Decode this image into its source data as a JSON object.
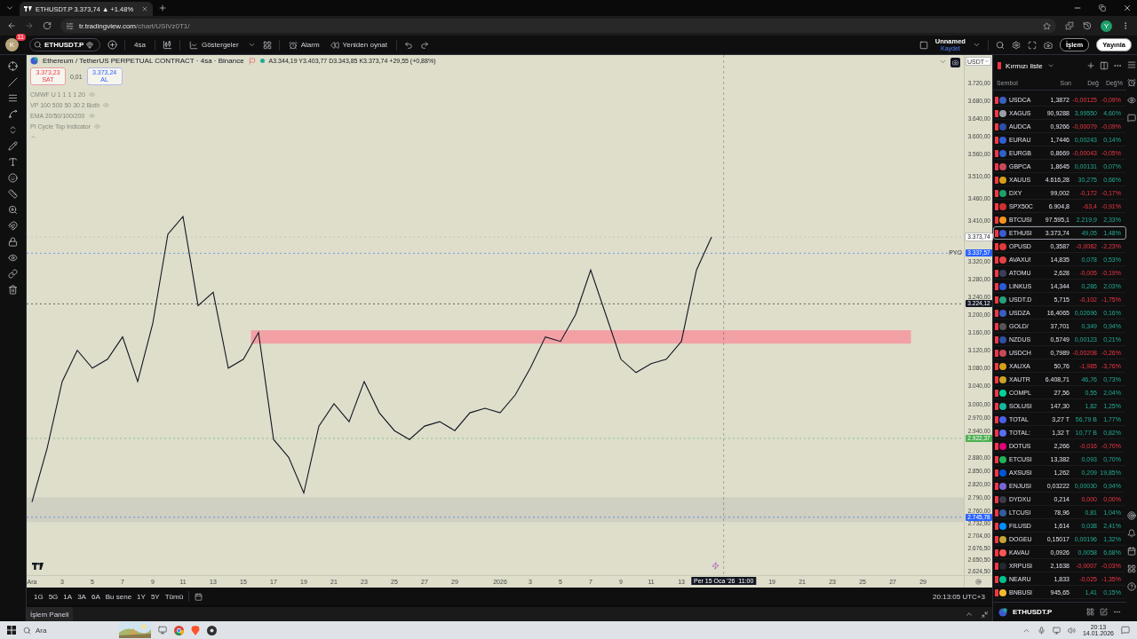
{
  "browser": {
    "tab_title": "ETHUSDT.P 3.373,74 ▲ +1.48%",
    "url_host": "tr.tradingview.com",
    "url_path": "/chart/USiVz0T1/",
    "profile": "Y"
  },
  "toolbar": {
    "avatar": "K",
    "badge": "11",
    "symbol": "ETHUSDT.P",
    "interval": "4sa",
    "indicators": "Göstergeler",
    "alarm": "Alarm",
    "replay": "Yeniden oynat",
    "layout_name": "Unnamed",
    "save": "Kaydet",
    "trade": "İşlem",
    "publish": "Yayınla"
  },
  "chart": {
    "title": "Ethereum / TetherUS PERPETUAL CONTRACT · 4sa · Binance",
    "ohlc": "A3.344,19 Y3.403,77 D3.343,85 K3.373,74 +29,55 (+0,88%)",
    "sell_price": "3.373,23",
    "sell_label": "SAT",
    "spread": "0,01",
    "buy_price": "3.373,24",
    "buy_label": "AL",
    "currency": "USDT",
    "axis_tag": "PYO",
    "indicators": [
      "CMWF U 1 1 1 1 20",
      "VP 100 500 50 30 2 Both",
      "EMA 20/50/100/200",
      "PI Cycle Top Indicator"
    ],
    "chart_data": {
      "type": "line",
      "categories": [
        "Ara",
        null,
        "3",
        null,
        "5",
        null,
        "7",
        null,
        "9",
        null,
        "11",
        null,
        "13",
        null,
        "15",
        null,
        "17",
        null,
        "19",
        null,
        "21",
        null,
        "23",
        null,
        "25",
        null,
        "27",
        null,
        "29",
        null,
        null,
        "2026",
        null,
        "3",
        null,
        "5",
        null,
        "7",
        null,
        "9",
        null,
        "11",
        null,
        "13",
        null,
        null,
        null,
        null,
        null,
        "19",
        null,
        "21",
        null,
        "23",
        null,
        "25",
        null,
        "27",
        null,
        "29",
        null,
        null
      ],
      "series": [
        {
          "color": "#131722",
          "values": [
            2780,
            2900,
            3050,
            3120,
            3080,
            3100,
            3150,
            3050,
            3180,
            3380,
            3420,
            3220,
            3250,
            3080,
            3100,
            3160,
            2920,
            2880,
            2800,
            2950,
            3000,
            2960,
            3050,
            2980,
            2940,
            2920,
            2950,
            2960,
            2940,
            2980,
            2990,
            2980,
            3020,
            3080,
            3150,
            3140,
            3200,
            3300,
            3200,
            3100,
            3070,
            3090,
            3100,
            3140,
            3300,
            3374,
            null,
            null,
            null,
            null,
            null,
            null,
            null,
            null,
            null,
            null,
            null,
            null,
            null,
            null,
            null,
            null
          ]
        }
      ],
      "ylim": [
        2616,
        3782
      ],
      "yticks": [
        {
          "value": 3720,
          "label": "3.720,00"
        },
        {
          "value": 3680,
          "label": "3.680,00"
        },
        {
          "value": 3640,
          "label": "3.640,00"
        },
        {
          "value": 3600,
          "label": "3.600,00"
        },
        {
          "value": 3560,
          "label": "3.560,00"
        },
        {
          "value": 3510,
          "label": "3.510,00"
        },
        {
          "value": 3460,
          "label": "3.460,00"
        },
        {
          "value": 3410,
          "label": "3.410,00"
        },
        {
          "value": 3320,
          "label": "3.320,00"
        },
        {
          "value": 3280,
          "label": "3.280,00"
        },
        {
          "value": 3240,
          "label": "3.240,00"
        },
        {
          "value": 3200,
          "label": "3.200,00"
        },
        {
          "value": 3160,
          "label": "3.160,00"
        },
        {
          "value": 3120,
          "label": "3.120,00"
        },
        {
          "value": 3080,
          "label": "3.080,00"
        },
        {
          "value": 3040,
          "label": "3.040,00"
        },
        {
          "value": 3000,
          "label": "3.000,00"
        },
        {
          "value": 2970,
          "label": "2.970,00"
        },
        {
          "value": 2940,
          "label": "2.940,00"
        },
        {
          "value": 2880,
          "label": "2.880,00"
        },
        {
          "value": 2850,
          "label": "2.850,00"
        },
        {
          "value": 2820,
          "label": "2.820,00"
        },
        {
          "value": 2790,
          "label": "2.790,00"
        },
        {
          "value": 2760,
          "label": "2.760,00"
        },
        {
          "value": 2732,
          "label": "2.732,00"
        },
        {
          "value": 2704,
          "label": "2.704,00"
        },
        {
          "value": 2676.5,
          "label": "2.676,50"
        },
        {
          "value": 2650.5,
          "label": "2.650,50"
        },
        {
          "value": 2624.5,
          "label": "2.624,50"
        }
      ],
      "bands": [
        {
          "axis": "y",
          "from": 3135,
          "to": 3165,
          "color": "#f2a0a4"
        },
        {
          "axis": "y",
          "from": 2735,
          "to": 2790,
          "color": "#cfcfc2"
        }
      ],
      "ref_lines": [
        {
          "axis": "y",
          "value": 3373.74,
          "label": "3.373,74",
          "color": "#b5b5b5"
        },
        {
          "axis": "y",
          "value": 3337.57,
          "label": "3.337,57",
          "color": "#2962ff"
        },
        {
          "axis": "y",
          "value": 3224.12,
          "label": "3.224,12",
          "color": "#131722"
        },
        {
          "axis": "y",
          "value": 2922.37,
          "label": "2.922,37",
          "color": "#4caf50"
        },
        {
          "axis": "y",
          "value": 2745.78,
          "label": "2.745,78",
          "color": "#2962ff"
        }
      ]
    },
    "crosshair_label": "Per 15 Oca '26  11:00"
  },
  "time": "20:13:05 UTC+3",
  "ranges": [
    "1G",
    "5G",
    "1A",
    "3A",
    "6A",
    "Bu sene",
    "1Y",
    "5Y",
    "Tümü"
  ],
  "panel_tab": "İşlem Paneli",
  "watchlist": {
    "title": "Kırmızı liste",
    "columns": [
      "Sembol",
      "Son",
      "Değ",
      "Değ%"
    ],
    "footer_symbol": "ETHUSDT.P",
    "rows": [
      {
        "symbol": "USDCA",
        "last": "1,3872",
        "change": "-0,00125",
        "change_pct": "-0,09%",
        "rising": false,
        "color": "#3b5fc0",
        "selected": false
      },
      {
        "symbol": "XAGUS",
        "last": "90,9288",
        "change": "3,99550",
        "change_pct": "4,60%",
        "rising": true,
        "color": "#9aa0a6",
        "selected": false
      },
      {
        "symbol": "AUDCA",
        "last": "0,9266",
        "change": "-0,00079",
        "change_pct": "-0,09%",
        "rising": false,
        "color": "#2f4fa8",
        "selected": false
      },
      {
        "symbol": "EURAU",
        "last": "1,7446",
        "change": "0,00243",
        "change_pct": "0,14%",
        "rising": true,
        "color": "#2f5fd0",
        "selected": false
      },
      {
        "symbol": "EURGB",
        "last": "0,8669",
        "change": "-0,00043",
        "change_pct": "-0,05%",
        "rising": false,
        "color": "#3060c8",
        "selected": false
      },
      {
        "symbol": "GBPCA",
        "last": "1,8645",
        "change": "0,00131",
        "change_pct": "0,07%",
        "rising": true,
        "color": "#c84a5a",
        "selected": false
      },
      {
        "symbol": "XAUUS",
        "last": "4.616,28",
        "change": "30,275",
        "change_pct": "0,66%",
        "rising": true,
        "color": "#d4a017",
        "selected": false
      },
      {
        "symbol": "DXY",
        "last": "99,002",
        "change": "-0,172",
        "change_pct": "-0,17%",
        "rising": false,
        "color": "#1e9e6a",
        "selected": false
      },
      {
        "symbol": "SPX50C",
        "last": "6.904,8",
        "change": "-63,4",
        "change_pct": "-0,91%",
        "rising": false,
        "color": "#d32f2f",
        "selected": false
      },
      {
        "symbol": "BTCUSI",
        "last": "97.595,1",
        "change": "2.219,9",
        "change_pct": "2,33%",
        "rising": true,
        "color": "#f7931a",
        "selected": false
      },
      {
        "symbol": "ETHUSI",
        "last": "3.373,74",
        "change": "49,05",
        "change_pct": "1,48%",
        "rising": true,
        "color": "#3c5bd0",
        "selected": true
      },
      {
        "symbol": "OPUSD",
        "last": "0,3587",
        "change": "-0,0082",
        "change_pct": "-2,23%",
        "rising": false,
        "color": "#e53935",
        "selected": false
      },
      {
        "symbol": "AVAXU!",
        "last": "14,835",
        "change": "0,078",
        "change_pct": "0,53%",
        "rising": true,
        "color": "#e84142",
        "selected": false
      },
      {
        "symbol": "ATOMU",
        "last": "2,628",
        "change": "-0,005",
        "change_pct": "-0,19%",
        "rising": false,
        "color": "#3a3f5c",
        "selected": false
      },
      {
        "symbol": "LINKUS",
        "last": "14,344",
        "change": "0,286",
        "change_pct": "2,03%",
        "rising": true,
        "color": "#2a5ada",
        "selected": false
      },
      {
        "symbol": "USDT.D",
        "last": "5,715",
        "change": "-0,102",
        "change_pct": "-1,75%",
        "rising": false,
        "color": "#26a17b",
        "selected": false
      },
      {
        "symbol": "USDZA",
        "last": "16,4065",
        "change": "0,02696",
        "change_pct": "0,16%",
        "rising": true,
        "color": "#3b5fc0",
        "selected": false
      },
      {
        "symbol": "GOLD/",
        "last": "37,701",
        "change": "0,349",
        "change_pct": "0,94%",
        "rising": true,
        "color": "#555555",
        "selected": false
      },
      {
        "symbol": "NZDUS",
        "last": "0,5749",
        "change": "0,00123",
        "change_pct": "0,21%",
        "rising": true,
        "color": "#2f4fa8",
        "selected": false
      },
      {
        "symbol": "USDCH",
        "last": "0,7989",
        "change": "-0,00208",
        "change_pct": "-0,26%",
        "rising": false,
        "color": "#c84a5a",
        "selected": false
      },
      {
        "symbol": "XAUXA",
        "last": "50,76",
        "change": "-1,985",
        "change_pct": "-3,76%",
        "rising": false,
        "color": "#d4a017",
        "selected": false
      },
      {
        "symbol": "XAUTR",
        "last": "6.408,71",
        "change": "46,76",
        "change_pct": "0,73%",
        "rising": true,
        "color": "#c9a227",
        "selected": false
      },
      {
        "symbol": "COMPL",
        "last": "27,56",
        "change": "0,55",
        "change_pct": "2,04%",
        "rising": true,
        "color": "#00d395",
        "selected": false
      },
      {
        "symbol": "SOLUSI",
        "last": "147,30",
        "change": "1,82",
        "change_pct": "1,25%",
        "rising": true,
        "color": "#14b89a",
        "selected": false
      },
      {
        "symbol": "TOTAL",
        "last": "3,27 T",
        "change": "56,79 B",
        "change_pct": "1,77%",
        "rising": true,
        "color": "#4a5ee8",
        "selected": false
      },
      {
        "symbol": "TOTAL:",
        "last": "1,32 T",
        "change": "10,77 B",
        "change_pct": "0,82%",
        "rising": true,
        "color": "#5a6ef0",
        "selected": false
      },
      {
        "symbol": "DOTUS",
        "last": "2,266",
        "change": "-0,016",
        "change_pct": "-0,70%",
        "rising": false,
        "color": "#e6007a",
        "selected": false
      },
      {
        "symbol": "ETCUSI",
        "last": "13,382",
        "change": "0,093",
        "change_pct": "0,70%",
        "rising": true,
        "color": "#1fb35a",
        "selected": false
      },
      {
        "symbol": "AXSUSI",
        "last": "1,262",
        "change": "0,209",
        "change_pct": "19,85%",
        "rising": true,
        "color": "#0055d5",
        "selected": false
      },
      {
        "symbol": "ENJUSI",
        "last": "0,03222",
        "change": "0,00030",
        "change_pct": "0,94%",
        "rising": true,
        "color": "#7866d5",
        "selected": false
      },
      {
        "symbol": "DYDXU",
        "last": "0,214",
        "change": "0,000",
        "change_pct": "0,00%",
        "rising": false,
        "color": "#3a3a4a",
        "selected": false
      },
      {
        "symbol": "LTCUSI",
        "last": "78,96",
        "change": "0,81",
        "change_pct": "1,04%",
        "rising": true,
        "color": "#345d9d",
        "selected": false
      },
      {
        "symbol": "FILUSD",
        "last": "1,614",
        "change": "0,038",
        "change_pct": "2,41%",
        "rising": true,
        "color": "#0090ff",
        "selected": false
      },
      {
        "symbol": "DOGEU",
        "last": "0,15017",
        "change": "0,00196",
        "change_pct": "1,32%",
        "rising": true,
        "color": "#c2a633",
        "selected": false
      },
      {
        "symbol": "KAVAU",
        "last": "0,0926",
        "change": "0,0058",
        "change_pct": "6,68%",
        "rising": true,
        "color": "#ff564f",
        "selected": false
      },
      {
        "symbol": "XRPUSI",
        "last": "2,1638",
        "change": "-0,0007",
        "change_pct": "-0,03%",
        "rising": false,
        "color": "#23292f",
        "selected": false
      },
      {
        "symbol": "NEARU",
        "last": "1,833",
        "change": "-0,025",
        "change_pct": "-1,35%",
        "rising": false,
        "color": "#00c08b",
        "selected": false
      },
      {
        "symbol": "BNBUSI",
        "last": "945,65",
        "change": "1,41",
        "change_pct": "0,15%",
        "rising": true,
        "color": "#f3ba2f",
        "selected": false
      }
    ]
  },
  "taskbar": {
    "search": "Ara",
    "time": "20:13",
    "date": "14.01.2026"
  }
}
